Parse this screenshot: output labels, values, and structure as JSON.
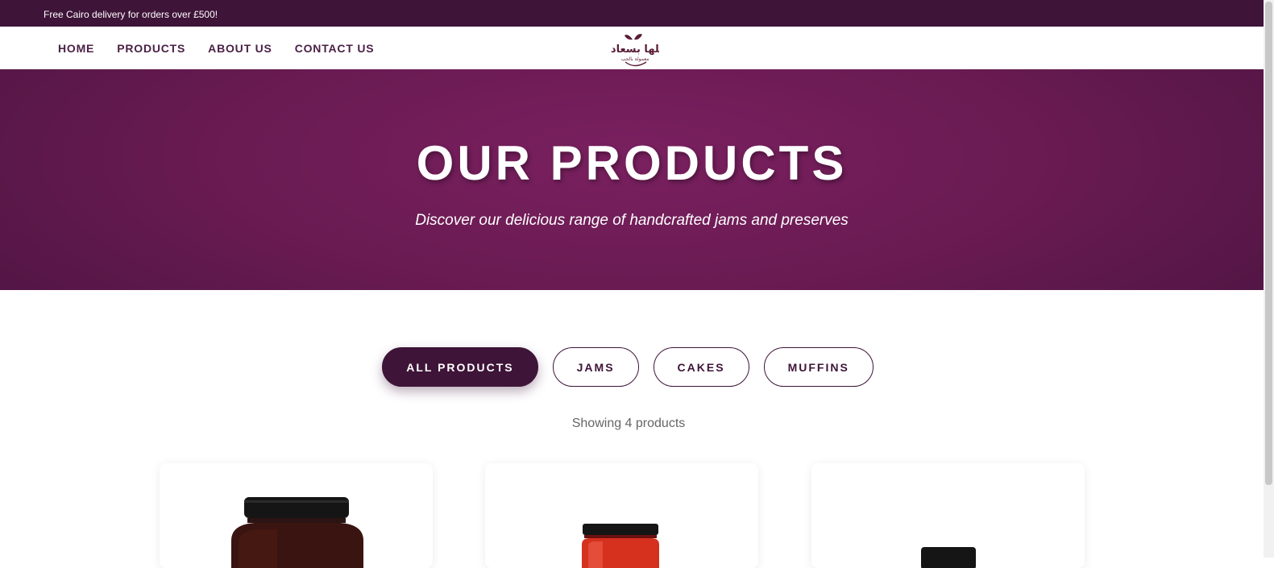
{
  "announcement": "Free Cairo delivery for orders over £500!",
  "nav": {
    "links": [
      "HOME",
      "PRODUCTS",
      "ABOUT US",
      "CONTACT US"
    ],
    "logo_text": "كلها بسعادة",
    "logo_tagline": "معمولة بالحب"
  },
  "hero": {
    "title": "OUR PRODUCTS",
    "subtitle": "Discover our delicious range of handcrafted jams and preserves"
  },
  "filters": [
    {
      "label": "ALL PRODUCTS",
      "active": true
    },
    {
      "label": "JAMS",
      "active": false
    },
    {
      "label": "CAKES",
      "active": false
    },
    {
      "label": "MUFFINS",
      "active": false
    }
  ],
  "product_count_text": "Showing 4 products",
  "products": [
    {
      "image": "dark-jam-jar-icon"
    },
    {
      "image": "red-jam-jar-icon"
    },
    {
      "image": "jar-lid-icon"
    }
  ],
  "colors": {
    "brand": "#3e1438",
    "hero": "#6a1b52",
    "nav_text": "#4a2146"
  }
}
